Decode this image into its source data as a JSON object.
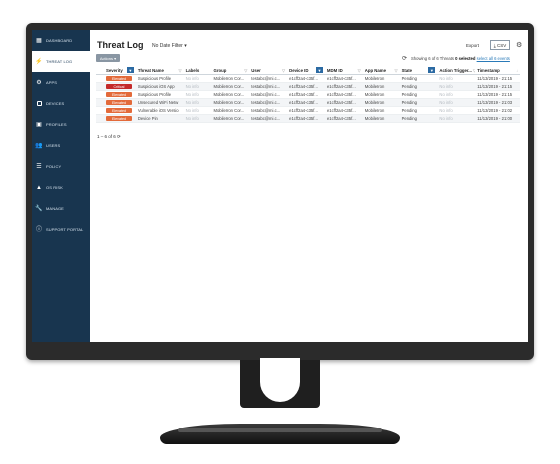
{
  "sidebar": {
    "items": [
      {
        "label": "DASHBOARD",
        "icon": "grid-icon"
      },
      {
        "label": "THREAT LOG",
        "icon": "bolt-icon"
      },
      {
        "label": "APPS",
        "icon": "gear-icon"
      },
      {
        "label": "DEVICES",
        "icon": "phone-icon"
      },
      {
        "label": "PROFILES",
        "icon": "profile-icon"
      },
      {
        "label": "USERS",
        "icon": "users-icon"
      },
      {
        "label": "POLICY",
        "icon": "policy-icon"
      },
      {
        "label": "OS RISK",
        "icon": "warning-icon"
      },
      {
        "label": "MANAGE",
        "icon": "wrench-icon"
      },
      {
        "label": "SUPPORT PORTAL",
        "icon": "info-icon"
      }
    ],
    "active_index": 1
  },
  "header": {
    "title": "Threat Log",
    "date_filter": "No Date Filter",
    "export_label": "Export",
    "csv_label": "CSV",
    "actions_label": "Actions"
  },
  "summary": {
    "showing": "Showing 6 of 6 Threats",
    "selected": "0 selected",
    "select_all": "select all 6 events"
  },
  "table": {
    "columns": [
      "Severity",
      "Threat Name",
      "Labels",
      "Group",
      "User",
      "Device ID",
      "MDM ID",
      "App Name",
      "State",
      "Action Trigger...",
      "Timestamp"
    ],
    "rows": [
      {
        "severity": "Elevated",
        "threat_name": "Suspicious Profile",
        "labels": "No info",
        "group": "MobileIron Cor...",
        "user": "testabc@mi.c...",
        "device_id": "e1cff2a4-c35f...",
        "mdm_id": "e1cff2a4-c35f...",
        "app_name": "MobileIron",
        "state": "Pending",
        "action": "No info",
        "timestamp": "11/13/2019 - 21:15"
      },
      {
        "severity": "Critical",
        "threat_name": "Suspicious iOS App",
        "labels": "No info",
        "group": "MobileIron Cor...",
        "user": "testabc@mi.c...",
        "device_id": "e1cff2a4-c35f...",
        "mdm_id": "e1cff2a4-c35f...",
        "app_name": "MobileIron",
        "state": "Pending",
        "action": "No info",
        "timestamp": "11/13/2019 - 21:15"
      },
      {
        "severity": "Elevated",
        "threat_name": "Suspicious Profile",
        "labels": "No info",
        "group": "MobileIron Cor...",
        "user": "testabc@mi.c...",
        "device_id": "e1cff2a4-c35f...",
        "mdm_id": "e1cff2a4-c35f...",
        "app_name": "MobileIron",
        "state": "Pending",
        "action": "No info",
        "timestamp": "11/13/2019 - 21:15"
      },
      {
        "severity": "Elevated",
        "threat_name": "Unsecured WiFi Netw",
        "labels": "No info",
        "group": "MobileIron Cor...",
        "user": "testabc@mi.c...",
        "device_id": "e1cff2a4-c35f...",
        "mdm_id": "e1cff2a4-c35f...",
        "app_name": "MobileIron",
        "state": "Pending",
        "action": "No info",
        "timestamp": "11/13/2019 - 21:03"
      },
      {
        "severity": "Elevated",
        "threat_name": "Vulnerable iOS Versio",
        "labels": "No info",
        "group": "MobileIron Cor...",
        "user": "testabc@mi.c...",
        "device_id": "e1cff2a4-c35f...",
        "mdm_id": "e1cff2a4-c35f...",
        "app_name": "MobileIron",
        "state": "Pending",
        "action": "No info",
        "timestamp": "11/13/2019 - 21:02"
      },
      {
        "severity": "Elevated",
        "threat_name": "Device Pin",
        "labels": "No info",
        "group": "MobileIron Cor...",
        "user": "testabc@mi.c...",
        "device_id": "e1cff2a4-c35f...",
        "mdm_id": "e1cff2a4-c35f...",
        "app_name": "MobileIron",
        "state": "Pending",
        "action": "No info",
        "timestamp": "11/13/2019 - 21:00"
      }
    ]
  },
  "pagination": "1 – 6 of 6",
  "colors": {
    "sidebar_bg": "#18354f",
    "elevated": "#e36a3a",
    "critical": "#c42a2a",
    "accent": "#2b6aa3"
  }
}
